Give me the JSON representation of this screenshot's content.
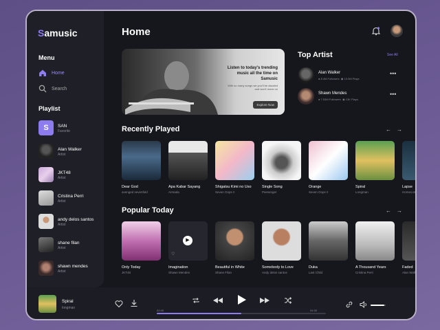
{
  "app": {
    "logo_initial": "S",
    "logo_rest": "amusic"
  },
  "sidebar": {
    "menu_title": "Menu",
    "nav": [
      {
        "label": "Home",
        "icon": "home-icon",
        "active": true
      },
      {
        "label": "Search",
        "icon": "search-icon",
        "active": false
      }
    ],
    "playlist_title": "Playlist",
    "playlists": [
      {
        "name": "SAN",
        "sub": "Favorite",
        "initial": "S"
      },
      {
        "name": "Alan Walker",
        "sub": "Artist"
      },
      {
        "name": "JKT48",
        "sub": "Artist"
      },
      {
        "name": "Cristina Perri",
        "sub": "Artist"
      },
      {
        "name": "andy delos santos",
        "sub": "Artist"
      },
      {
        "name": "shane filan",
        "sub": "Artist"
      },
      {
        "name": "shawn mendes",
        "sub": "Artist"
      }
    ]
  },
  "header": {
    "title": "Home"
  },
  "hero": {
    "headline": "Listen to today's trending music all the time on Samusic",
    "subtext": "With so many songs we you'll be dazzled and won't move on",
    "button": "Explore Now"
  },
  "top_artist": {
    "title": "Top Artist",
    "see_all": "See All",
    "artists": [
      {
        "name": "Alan Walker",
        "followers": "8.4M Followers",
        "plays": "13.9M Plays"
      },
      {
        "name": "Shawn Mendes",
        "followers": "7.53M Followers",
        "plays": "13K Plays"
      }
    ]
  },
  "recently_played": {
    "title": "Recently Played",
    "items": [
      {
        "title": "Dear God",
        "artist": "avenged sevenfold"
      },
      {
        "title": "Apa Kabar Sayang",
        "artist": "Armada"
      },
      {
        "title": "Shigatsu Kimi no Uso",
        "artist": "Seven Oops !!"
      },
      {
        "title": "Single Song",
        "artist": "Passenger"
      },
      {
        "title": "Orange",
        "artist": "Seven Oops !!"
      },
      {
        "title": "Spiral",
        "artist": "Longman"
      },
      {
        "title": "Lapse",
        "artist": "Homecoming"
      }
    ]
  },
  "popular_today": {
    "title": "Popular Today",
    "items": [
      {
        "title": "Only Today",
        "artist": "JKT48"
      },
      {
        "title": "Imagination",
        "artist": "Shawn Mendes"
      },
      {
        "title": "Beautiful in White",
        "artist": "Shane Filan"
      },
      {
        "title": "Somebody to Love",
        "artist": "Andy delos santos"
      },
      {
        "title": "Duka",
        "artist": "Last Child"
      },
      {
        "title": "A Thousand Years",
        "artist": "Cristina Perri"
      },
      {
        "title": "Faded",
        "artist": "Alan Walker"
      }
    ]
  },
  "player": {
    "title": "Spiral",
    "artist": "longman",
    "elapsed": "02:45",
    "total": "04:30",
    "progress": 0.5,
    "volume": 0.9
  },
  "colors": {
    "accent": "#8d7bf0",
    "frame": "#16161d",
    "panel": "#1f1f27"
  }
}
